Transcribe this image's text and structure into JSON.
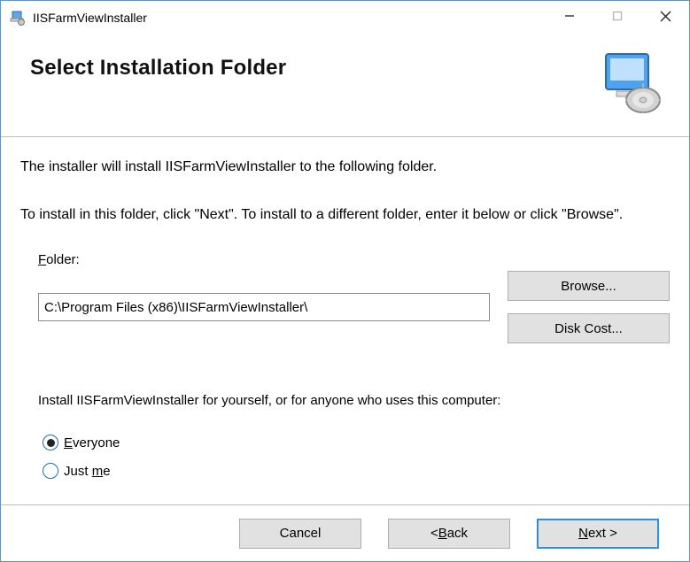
{
  "titlebar": {
    "title": "IISFarmViewInstaller"
  },
  "header": {
    "heading": "Select Installation Folder"
  },
  "main": {
    "intro_line1": "The installer will install IISFarmViewInstaller to the following folder.",
    "intro_line2": "To install in this folder, click \"Next\". To install to a different folder, enter it below or click \"Browse\".",
    "folder_label_pre": "F",
    "folder_label_rest": "older:",
    "path": "C:\\Program Files (x86)\\IISFarmViewInstaller\\",
    "browse_label": "Browse...",
    "disk_cost_pre": "Disk Cost...",
    "install_for_text": "Install IISFarmViewInstaller for yourself, or for anyone who uses this computer:",
    "radio_everyone_pre": "E",
    "radio_everyone_rest": "veryone",
    "radio_justme_pre": "Just ",
    "radio_justme_ul": "m",
    "radio_justme_rest": "e",
    "selected": "everyone"
  },
  "footer": {
    "cancel": "Cancel",
    "back_lt": "< ",
    "back_ul": "B",
    "back_rest": "ack",
    "next_ul": "N",
    "next_rest": "ext >"
  }
}
